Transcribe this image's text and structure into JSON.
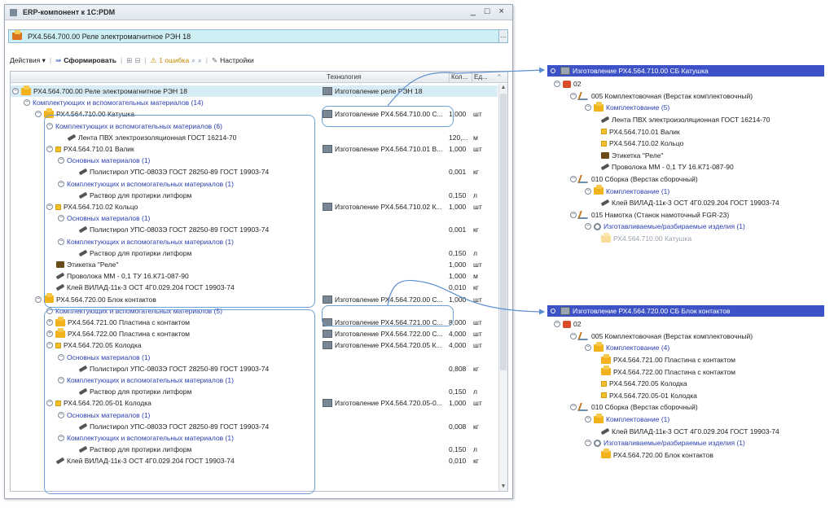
{
  "window": {
    "title": "ERP-компонент к 1С:PDM",
    "controls": "_ □ ×",
    "header_field": "РХ4.564.700.00 Реле электромагнитное РЭН 18",
    "header_more": "..."
  },
  "toolbar": {
    "actions": "Действия ▾",
    "generate": "Сформировать",
    "errors": "1 ошибка",
    "settings": "Настройки"
  },
  "grid": {
    "columns": [
      "Технология",
      "Кол...",
      "Ед..."
    ],
    "rows": [
      {
        "name": "РХ4.564.700.00 Реле электромагнитное РЭН 18",
        "tech": "Изготовление реле РЭН 18",
        "qty": "",
        "unit": ""
      },
      {
        "name": "Комплектующих и вспомогательных материалов (14)",
        "tech": "",
        "qty": "",
        "unit": ""
      },
      {
        "name": "РХ4.564.710.00 Катушка",
        "tech": "Изготовление РХ4.564.710.00 С...",
        "qty": "1,000",
        "unit": "шт"
      },
      {
        "name": "Комплектующих и вспомогательных материалов (6)",
        "tech": "",
        "qty": "",
        "unit": ""
      },
      {
        "name": "Лента  ПВХ электроизоляционная  ГОСТ 16214-70",
        "tech": "",
        "qty": "120,...",
        "unit": "м"
      },
      {
        "name": "РХ4.564.710.01 Валик",
        "tech": "Изготовление РХ4.564.710.01 В...",
        "qty": "1,000",
        "unit": "шт"
      },
      {
        "name": "Основных материалов (1)",
        "tech": "",
        "qty": "",
        "unit": ""
      },
      {
        "name": "Полистирол УПС-0803Э  ГОСТ 28250-89  ГОСТ 19903-74",
        "tech": "",
        "qty": "0,001",
        "unit": "кг"
      },
      {
        "name": "Комплектующих и вспомогательных материалов (1)",
        "tech": "",
        "qty": "",
        "unit": ""
      },
      {
        "name": "Раствор для протирки литформ",
        "tech": "",
        "qty": "0,150",
        "unit": "л"
      },
      {
        "name": "РХ4.564.710.02 Кольцо",
        "tech": "Изготовление РХ4.564.710.02 К...",
        "qty": "1,000",
        "unit": "шт"
      },
      {
        "name": "Основных материалов (1)",
        "tech": "",
        "qty": "",
        "unit": ""
      },
      {
        "name": "Полистирол УПС-0803Э  ГОСТ 28250-89  ГОСТ 19903-74",
        "tech": "",
        "qty": "0,001",
        "unit": "кг"
      },
      {
        "name": "Комплектующих и вспомогательных материалов (1)",
        "tech": "",
        "qty": "",
        "unit": ""
      },
      {
        "name": "Раствор для протирки литформ",
        "tech": "",
        "qty": "0,150",
        "unit": "л"
      },
      {
        "name": "Этикетка \"Реле\"",
        "tech": "",
        "qty": "1,000",
        "unit": "шт"
      },
      {
        "name": "Проволока ММ - 0,1 ТУ 16.К71-087-90",
        "tech": "",
        "qty": "1,000",
        "unit": "м"
      },
      {
        "name": "Клей ВИЛАД-11к-3 ОСТ 4Г0.029.204 ГОСТ 19903-74",
        "tech": "",
        "qty": "0,010",
        "unit": "кг"
      },
      {
        "name": "РХ4.564.720.00 Блок контактов",
        "tech": "Изготовление РХ4.564.720.00 С...",
        "qty": "1,000",
        "unit": "шт"
      },
      {
        "name": "Комплектующих и вспомогательных материалов (5)",
        "tech": "",
        "qty": "",
        "unit": ""
      },
      {
        "name": "РХ4.564.721.00 Пластина с контактом",
        "tech": "Изготовление РХ4.564.721.00 С...",
        "qty": "8,000",
        "unit": "шт"
      },
      {
        "name": "РХ4.564.722.00 Пластина с контактом",
        "tech": "Изготовление РХ4.564.722.00 С...",
        "qty": "4,000",
        "unit": "шт"
      },
      {
        "name": "РХ4.564.720.05 Колодка",
        "tech": "Изготовление РХ4.564.720.05 К...",
        "qty": "4,000",
        "unit": "шт"
      },
      {
        "name": "Основных материалов (1)",
        "tech": "",
        "qty": "",
        "unit": ""
      },
      {
        "name": "Полистирол УПС-0803Э  ГОСТ 28250-89  ГОСТ 19903-74",
        "tech": "",
        "qty": "0,808",
        "unit": "кг"
      },
      {
        "name": "Комплектующих и вспомогательных материалов (1)",
        "tech": "",
        "qty": "",
        "unit": ""
      },
      {
        "name": "Раствор для протирки литформ",
        "tech": "",
        "qty": "0,150",
        "unit": "л"
      },
      {
        "name": "РХ4.564.720.05-01 Колодка",
        "tech": "Изготовление РХ4.564.720.05-0...",
        "qty": "1,000",
        "unit": "шт"
      },
      {
        "name": "Основных материалов (1)",
        "tech": "",
        "qty": "",
        "unit": ""
      },
      {
        "name": "Полистирол УПС-0803Э  ГОСТ 28250-89  ГОСТ 19903-74",
        "tech": "",
        "qty": "0,008",
        "unit": "кг"
      },
      {
        "name": "Комплектующих и вспомогательных материалов (1)",
        "tech": "",
        "qty": "",
        "unit": ""
      },
      {
        "name": "Раствор для протирки литформ",
        "tech": "",
        "qty": "0,150",
        "unit": "л"
      },
      {
        "name": "Клей ВИЛАД-11к-3 ОСТ 4Г0.029.204 ГОСТ 19903-74",
        "tech": "",
        "qty": "0,010",
        "unit": "кг"
      }
    ]
  },
  "panel1": {
    "title": "Изготовление РХ4.564.710.00 СБ Катушка",
    "rows": [
      "02",
      "005 Комплектовочная (Верстак комплектовочный)",
      "Комплектование (5)",
      "Лента  ПВХ электроизоляционная  ГОСТ 16214-70",
      "РХ4.564.710.01 Валик",
      "РХ4.564.710.02 Кольцо",
      "Этикетка \"Реле\"",
      "Проволока ММ - 0,1 ТУ 16.К71-087-90",
      "010 Сборка (Верстак сборочный)",
      "Комплектование (1)",
      "Клей ВИЛАД-11к-3 ОСТ 4Г0.029.204 ГОСТ 19903-74",
      "015 Намотка (Станок намоточный FGR-23)",
      "Изготавливаемые/разбираемые изделия (1)",
      "РХ4.564.710.00 Катушка"
    ]
  },
  "panel2": {
    "title": "Изготовление РХ4.564.720.00 СБ Блок контактов",
    "rows": [
      "02",
      "005 Комплектовочная (Верстак комплектовочный)",
      "Комплектование (4)",
      "РХ4.564.721.00 Пластина с контактом",
      "РХ4.564.722.00 Пластина с контактом",
      "РХ4.564.720.05 Колодка",
      "РХ4.564.720.05-01 Колодка",
      "010 Сборка (Верстак сборочный)",
      "Комплектование (1)",
      "Клей ВИЛАД-11к-3 ОСТ 4Г0.029.204 ГОСТ 19903-74",
      "Изготавливаемые/разбираемые изделия (1)",
      "РХ4.564.720.00 Блок контактов"
    ]
  }
}
